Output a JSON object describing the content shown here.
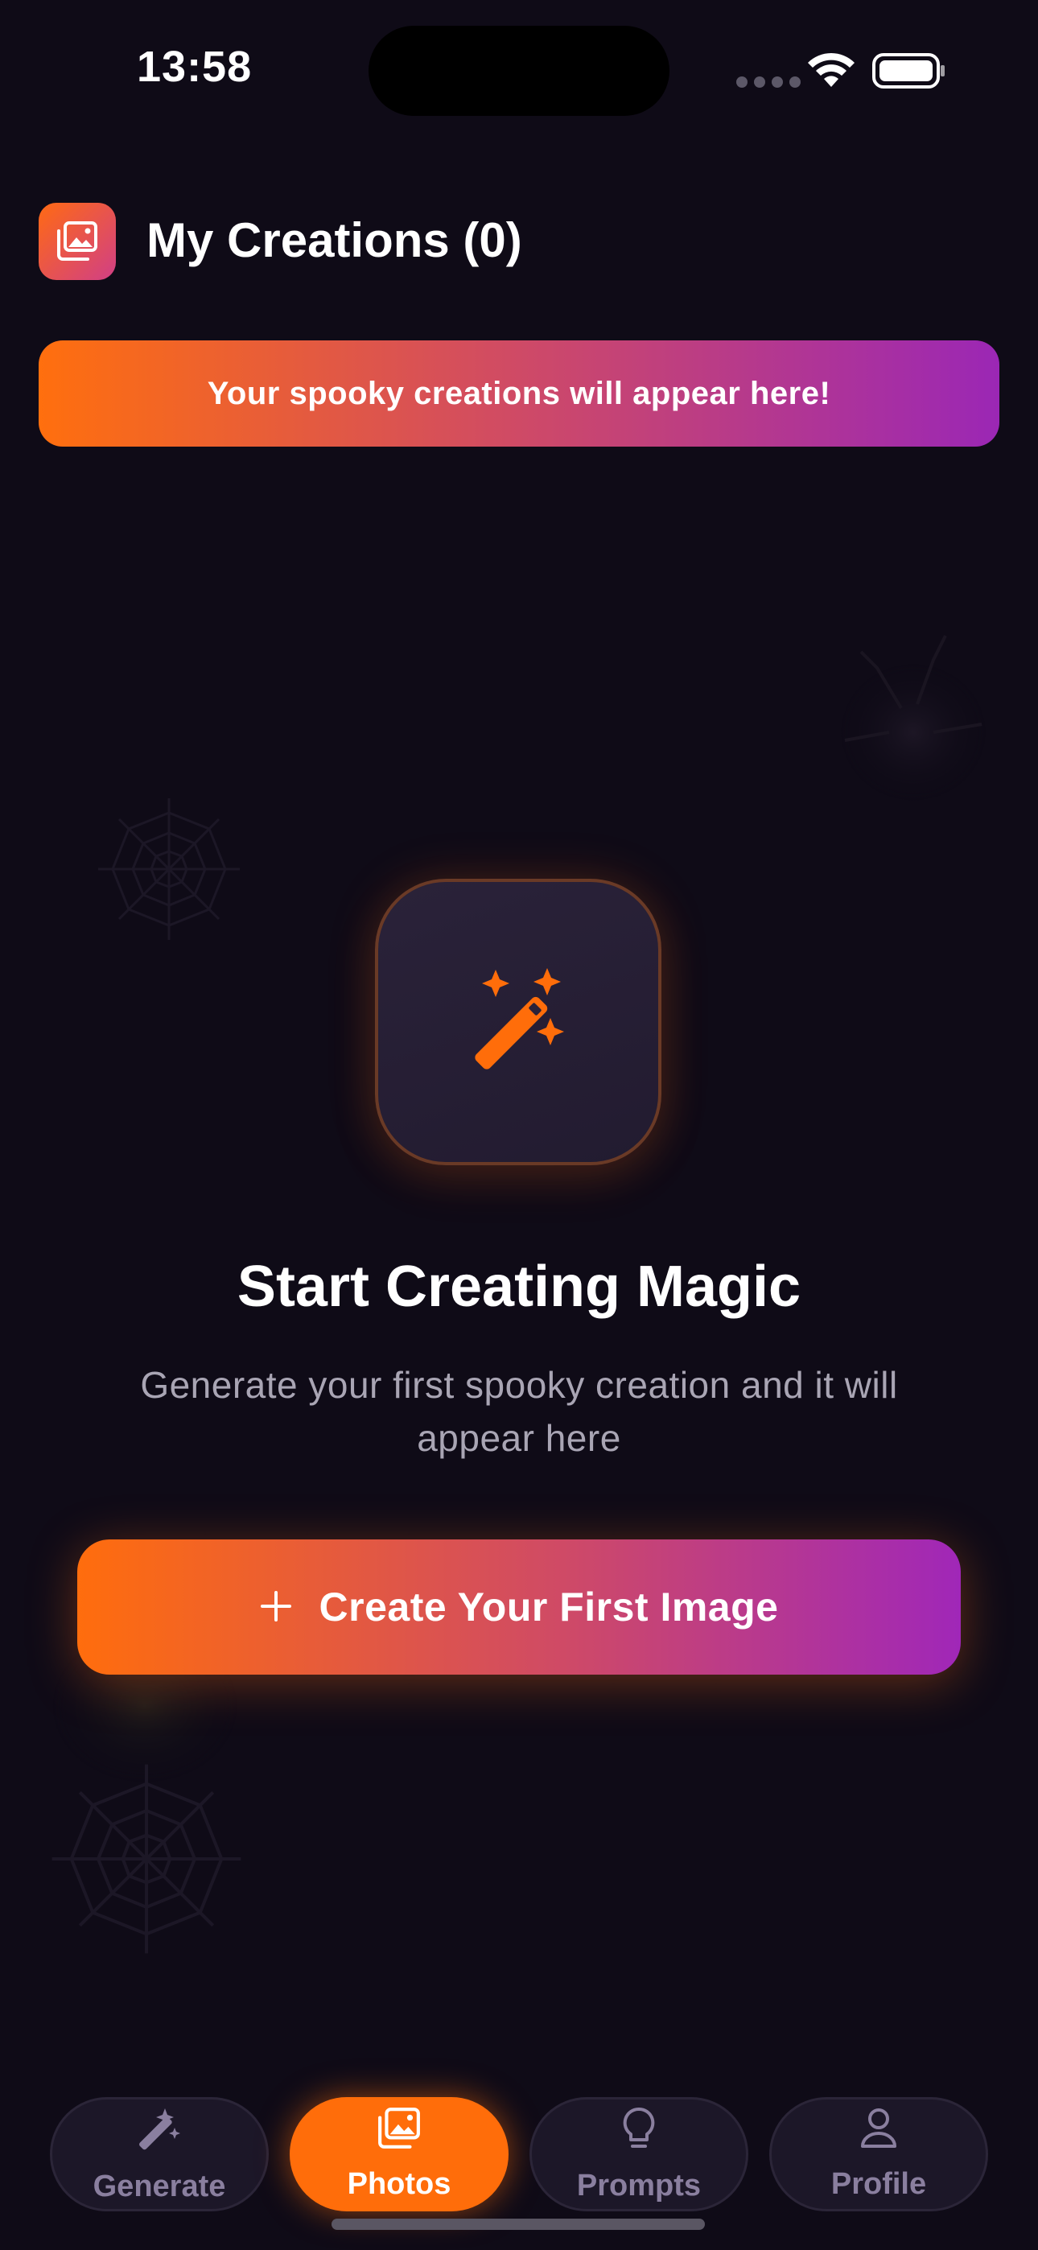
{
  "status_bar": {
    "time": "13:58"
  },
  "header": {
    "title": "My Creations (0)",
    "icon": "photo-stack-icon"
  },
  "banner": {
    "text": "Your spooky creations will appear here!"
  },
  "empty_state": {
    "icon": "magic-wand-icon",
    "title": "Start Creating Magic",
    "description": "Generate your first spooky creation and it will appear here"
  },
  "cta": {
    "icon": "plus-icon",
    "label": "Create Your First Image"
  },
  "tabs": [
    {
      "label": "Generate",
      "icon": "magic-wand-icon",
      "active": false
    },
    {
      "label": "Photos",
      "icon": "photo-stack-icon",
      "active": true
    },
    {
      "label": "Prompts",
      "icon": "lightbulb-icon",
      "active": false
    },
    {
      "label": "Profile",
      "icon": "person-icon",
      "active": false
    }
  ],
  "colors": {
    "background": "#0f0b17",
    "accent_orange": "#ff6d0a",
    "accent_purple": "#9b27b5",
    "tab_inactive_text": "#8a7f9f",
    "muted_text": "#a9a5b4"
  }
}
